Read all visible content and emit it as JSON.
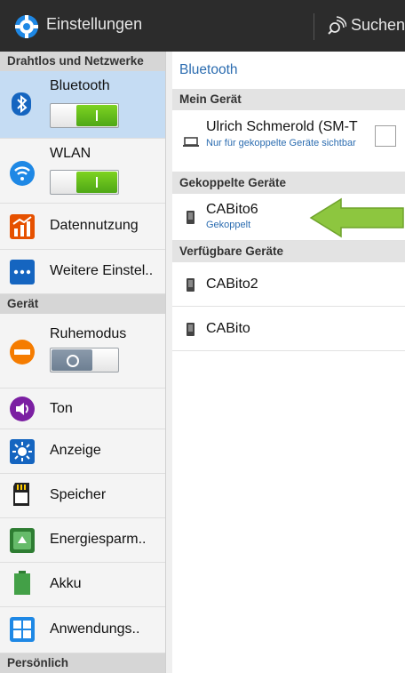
{
  "actionbar": {
    "title": "Einstellungen",
    "search_label": "Suchen"
  },
  "left": {
    "sections": {
      "wireless": "Drahtlos und Netzwerke",
      "device": "Gerät",
      "personal": "Persönlich"
    },
    "items": {
      "bluetooth": "Bluetooth",
      "wlan": "WLAN",
      "datenverbrauch": "Datennutzung",
      "weitere": "Weitere Einstel..",
      "ruhemodus": "Ruhemodus",
      "ton": "Ton",
      "anzeige": "Anzeige",
      "speicher": "Speicher",
      "energie": "Energiesparm..",
      "akku": "Akku",
      "anwendungen": "Anwendungs.."
    },
    "toggles": {
      "bluetooth": "on",
      "wlan": "on",
      "ruhemodus": "off"
    }
  },
  "right": {
    "title": "Bluetooth",
    "my_device_header": "Mein Gerät",
    "my_device_name": "Ulrich Schmerold (SM-T",
    "my_device_sub": "Nur für gekoppelte Geräte sichtbar",
    "paired_header": "Gekoppelte Geräte",
    "paired": [
      {
        "name": "CABito6",
        "status": "Gekoppelt"
      }
    ],
    "available_header": "Verfügbare Geräte",
    "available": [
      {
        "name": "CABito2"
      },
      {
        "name": "CABito"
      }
    ]
  },
  "colors": {
    "actionbar": "#2c2c2c",
    "selected": "#c5dcf3",
    "accent": "#2b6cb0",
    "toggle_on": "#5cb81a",
    "arrow": "#8dc63f"
  }
}
